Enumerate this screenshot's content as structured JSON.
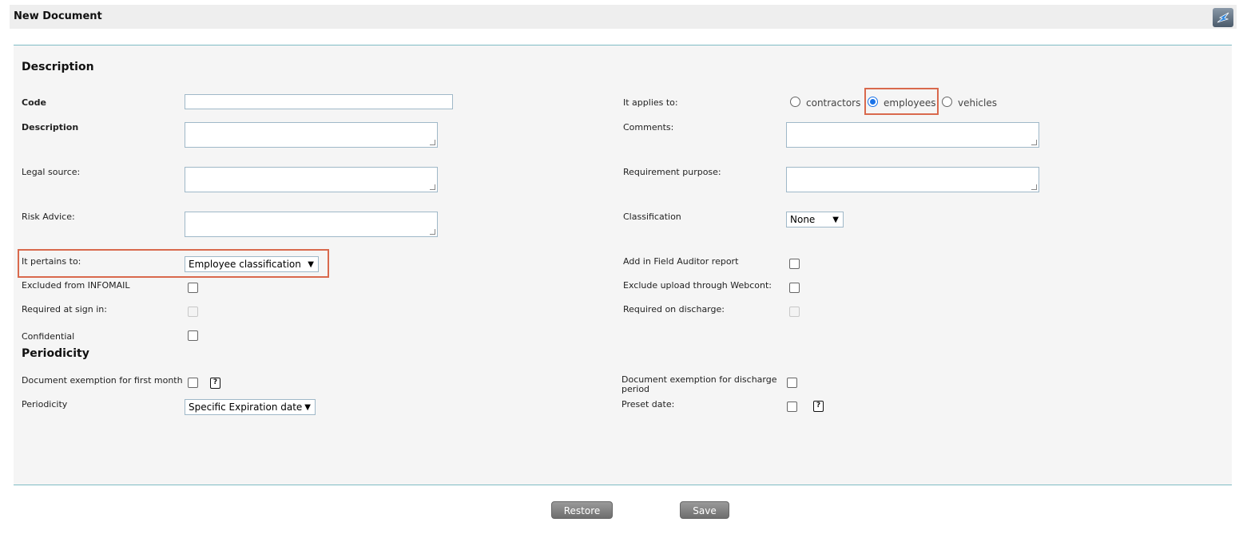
{
  "header": {
    "title": "New Document",
    "back_icon": "back-arrow-icon"
  },
  "description": {
    "section_title": "Description",
    "code_label": "Code",
    "code_value": "",
    "description_label": "Description",
    "legal_source_label": "Legal source:",
    "risk_advice_label": "Risk Advice:",
    "pertains_label": "It pertains to:",
    "pertains_value": "Employee classification",
    "excluded_infomail_label": "Excluded from INFOMAIL",
    "required_signin_label": "Required at sign in:",
    "confidential_label": "Confidential",
    "applies_label": "It applies to:",
    "applies_options": [
      "contractors",
      "employees",
      "vehicles"
    ],
    "applies_selected": "employees",
    "comments_label": "Comments:",
    "requirement_purpose_label": "Requirement purpose:",
    "classification_label": "Classification",
    "classification_value": "None",
    "field_auditor_label": "Add in Field Auditor report",
    "exclude_webcont_label": "Exclude upload through Webcont:",
    "required_discharge_label": "Required on discharge:"
  },
  "periodicity": {
    "section_title": "Periodicity",
    "exemption_first_month_label": "Document exemption for first month",
    "periodicity_label": "Periodicity",
    "periodicity_value": "Specific Expiration date",
    "exemption_discharge_label_line1": "Document exemption for discharge",
    "exemption_discharge_label_line2": "period",
    "preset_date_label": "Preset date:",
    "help_glyph": "?"
  },
  "footer": {
    "restore_label": "Restore",
    "save_label": "Save"
  },
  "colors": {
    "highlight": "#d9694d",
    "panel_border": "#7fbcc4",
    "radio_selected": "#1a73e8"
  }
}
